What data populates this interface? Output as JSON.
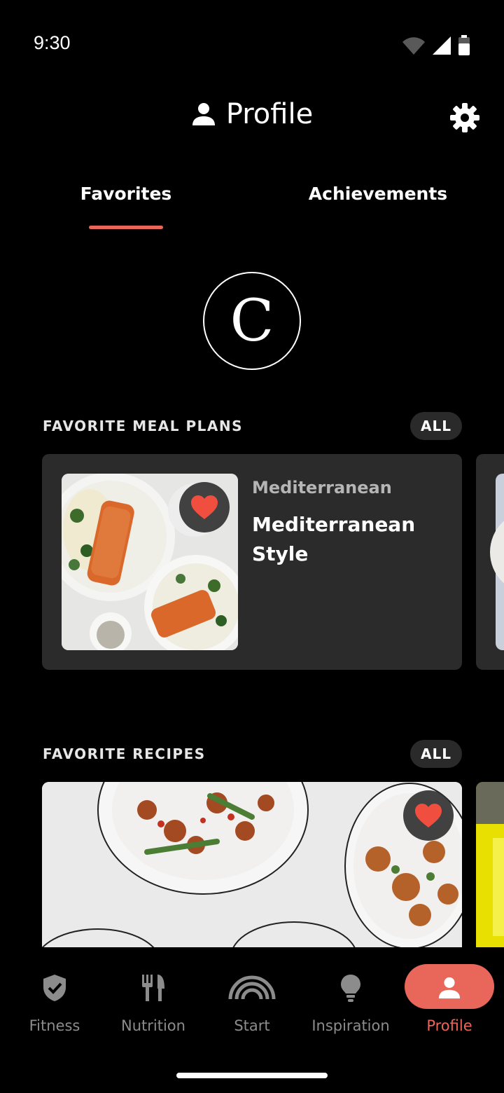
{
  "status_bar": {
    "time": "9:30"
  },
  "header": {
    "title": "Profile",
    "settings_icon": "gear-icon",
    "profile_icon": "person-icon"
  },
  "tabs": [
    {
      "label": "Favorites",
      "active": true
    },
    {
      "label": "Achievements",
      "active": false
    }
  ],
  "avatar": {
    "initial": "C"
  },
  "meal_plans": {
    "title": "FAVORITE MEAL PLANS",
    "all_label": "ALL",
    "items": [
      {
        "category": "Mediterranean",
        "title": "Mediterranean Style",
        "favorited": true
      }
    ]
  },
  "recipes": {
    "title": "FAVORITE RECIPES",
    "all_label": "ALL",
    "items": [
      {
        "favorited": true
      }
    ]
  },
  "bottom_nav": {
    "items": [
      {
        "label": "Fitness",
        "icon": "shield-check-icon"
      },
      {
        "label": "Nutrition",
        "icon": "fork-knife-icon"
      },
      {
        "label": "Start",
        "icon": "rainbow-icon"
      },
      {
        "label": "Inspiration",
        "icon": "lightbulb-icon"
      },
      {
        "label": "Profile",
        "icon": "person-icon",
        "active": true
      }
    ]
  },
  "colors": {
    "accent": "#e8675a",
    "card": "#2b2b2b",
    "background": "#000000"
  }
}
